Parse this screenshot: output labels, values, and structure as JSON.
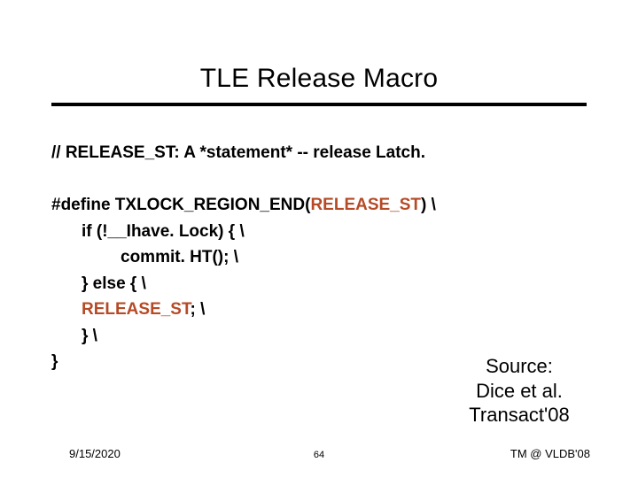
{
  "title": "TLE Release Macro",
  "comment": "// RELEASE_ST: A *statement* -- release Latch.",
  "code": {
    "l1_pre": "#define TXLOCK_REGION_END(",
    "l1_accent": "RELEASE_ST",
    "l1_post": ") \\",
    "l2": "if (!__Ihave. Lock) { \\",
    "l3": "commit. HT(); \\",
    "l4": "} else { \\",
    "l5_accent": "RELEASE_ST",
    "l5_post": "; \\",
    "l6": "} \\",
    "l7": "}"
  },
  "source": {
    "l1": "Source:",
    "l2": "Dice et al.",
    "l3": "Transact'08"
  },
  "footer": {
    "date": "9/15/2020",
    "page": "64",
    "venue": "TM @ VLDB'08"
  }
}
